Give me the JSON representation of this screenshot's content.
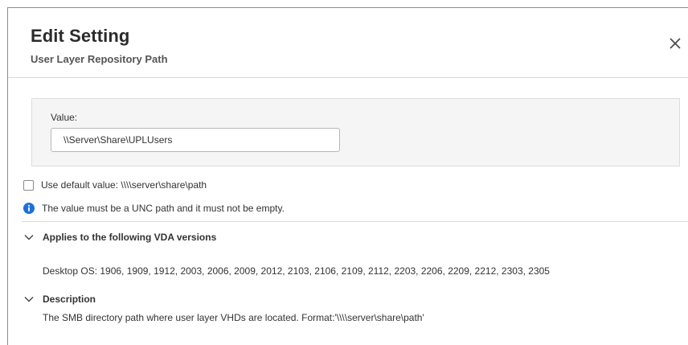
{
  "dialog": {
    "title": "Edit Setting",
    "subtitle": "User Layer Repository Path",
    "close_icon": "close-icon"
  },
  "value": {
    "label": "Value:",
    "input_value": "\\\\Server\\Share\\UPLUsers"
  },
  "default_option": {
    "checked": false,
    "label": "Use default value: \\\\\\\\server\\share\\path"
  },
  "info": {
    "icon": "info-icon",
    "text": "The value must be a UNC path and it must not be empty."
  },
  "applies_section": {
    "icon": "chevron-down-icon",
    "title": "Applies to the following VDA versions",
    "content": "Desktop OS: 1906, 1909, 1912, 2003, 2006, 2009, 2012, 2103, 2106, 2109, 2112, 2203, 2206, 2209, 2212, 2303, 2305"
  },
  "description_section": {
    "icon": "chevron-down-icon",
    "title": "Description",
    "content": "The SMB directory path where user layer VHDs are located. Format:'\\\\\\\\server\\share\\path'"
  },
  "colors": {
    "info_blue": "#1e6fd9",
    "border": "#d8d8d8",
    "panel_background": "#f5f5f5"
  }
}
